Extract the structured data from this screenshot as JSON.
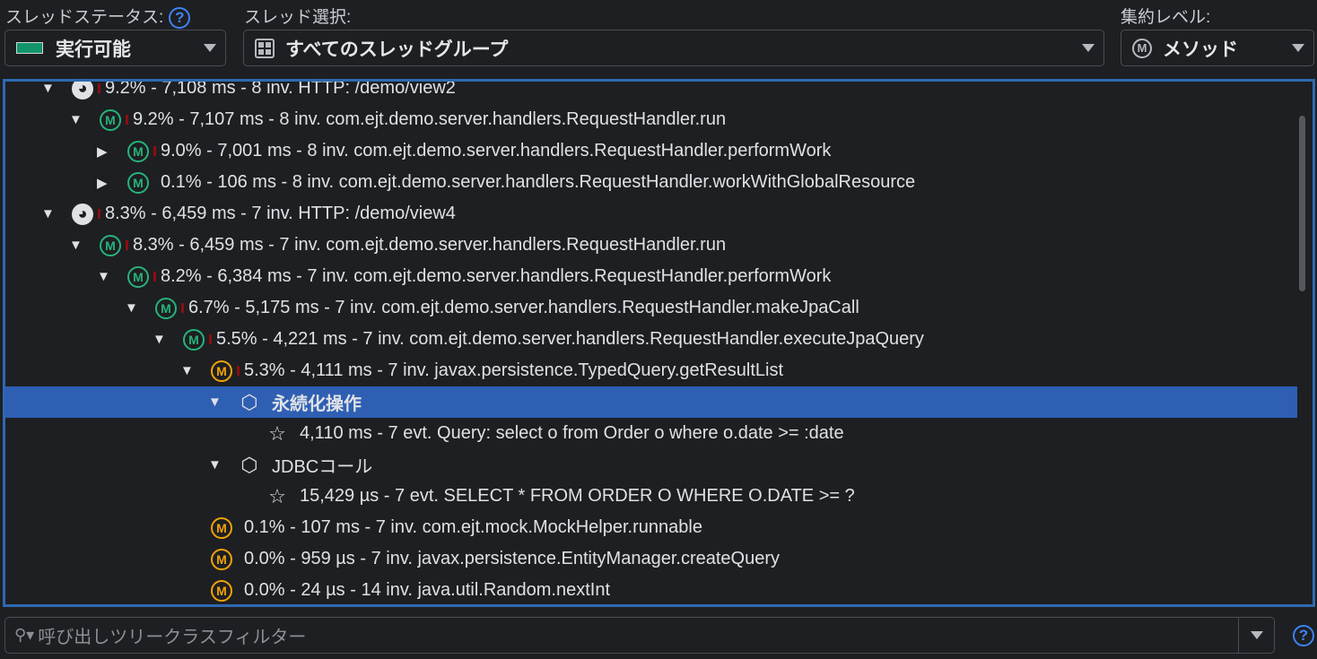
{
  "header": {
    "thread_status_label": "スレッドステータス:",
    "thread_status_value": "実行可能",
    "thread_select_label": "スレッド選択:",
    "thread_select_value": "すべてのスレッドグループ",
    "aggregation_label": "集約レベル:",
    "aggregation_value": "メソッド",
    "help": "?"
  },
  "tree": [
    {
      "level": 0,
      "arrow": "▼",
      "icon": "globe",
      "bar": true,
      "text": "9.2% - 7,108 ms - 8 inv. HTTP: /demo/view2"
    },
    {
      "level": 1,
      "arrow": "▼",
      "icon": "method-green",
      "bar": true,
      "text": "9.2% - 7,107 ms - 8 inv. com.ejt.demo.server.handlers.RequestHandler.run"
    },
    {
      "level": 2,
      "arrow": "▶",
      "icon": "method-green",
      "bar": true,
      "text": "9.0% - 7,001 ms - 8 inv. com.ejt.demo.server.handlers.RequestHandler.performWork"
    },
    {
      "level": 2,
      "arrow": "▶",
      "icon": "method-green",
      "bar": false,
      "text": "0.1% - 106 ms - 8 inv. com.ejt.demo.server.handlers.RequestHandler.workWithGlobalResource"
    },
    {
      "level": 0,
      "arrow": "▼",
      "icon": "globe",
      "bar": true,
      "text": "8.3% - 6,459 ms - 7 inv. HTTP: /demo/view4"
    },
    {
      "level": 1,
      "arrow": "▼",
      "icon": "method-green",
      "bar": true,
      "text": "8.3% - 6,459 ms - 7 inv. com.ejt.demo.server.handlers.RequestHandler.run"
    },
    {
      "level": 2,
      "arrow": "▼",
      "icon": "method-green",
      "bar": true,
      "text": "8.2% - 6,384 ms - 7 inv. com.ejt.demo.server.handlers.RequestHandler.performWork"
    },
    {
      "level": 3,
      "arrow": "▼",
      "icon": "method-green",
      "bar": true,
      "text": "6.7% - 5,175 ms - 7 inv. com.ejt.demo.server.handlers.RequestHandler.makeJpaCall"
    },
    {
      "level": 4,
      "arrow": "▼",
      "icon": "method-green",
      "bar": true,
      "text": "5.5% - 4,221 ms - 7 inv. com.ejt.demo.server.handlers.RequestHandler.executeJpaQuery"
    },
    {
      "level": 5,
      "arrow": "▼",
      "icon": "method-orange",
      "bar": true,
      "text": "5.3% - 4,111 ms - 7 inv. javax.persistence.TypedQuery.getResultList"
    },
    {
      "level": 6,
      "arrow": "▼",
      "icon": "box",
      "bar": false,
      "text": "永続化操作",
      "selected": true
    },
    {
      "level": 7,
      "arrow": "",
      "icon": "star",
      "bar": false,
      "text": "4,110 ms - 7 evt. Query: select o from Order o where o.date >= :date"
    },
    {
      "level": 6,
      "arrow": "▼",
      "icon": "box",
      "bar": false,
      "text": "JDBCコール"
    },
    {
      "level": 7,
      "arrow": "",
      "icon": "star",
      "bar": false,
      "text": "15,429 µs - 7 evt. SELECT * FROM ORDER O WHERE O.DATE >= ?"
    },
    {
      "level": 5,
      "arrow": "",
      "icon": "method-orange",
      "bar": false,
      "text": "0.1% - 107 ms - 7 inv. com.ejt.mock.MockHelper.runnable"
    },
    {
      "level": 5,
      "arrow": "",
      "icon": "method-orange",
      "bar": false,
      "text": "0.0% - 959 µs - 7 inv. javax.persistence.EntityManager.createQuery"
    },
    {
      "level": 5,
      "arrow": "",
      "icon": "method-orange",
      "bar": false,
      "text": "0.0% - 24 µs - 14 inv. java.util.Random.nextInt"
    }
  ],
  "filter": {
    "placeholder": "呼び出しツリークラスフィルター"
  },
  "colors": {
    "selection": "#2e5fb3",
    "focus_border": "#2d6ab0",
    "method_green": "#27b37a",
    "method_orange": "#f0a30a",
    "status_runnable": "#12956b"
  }
}
